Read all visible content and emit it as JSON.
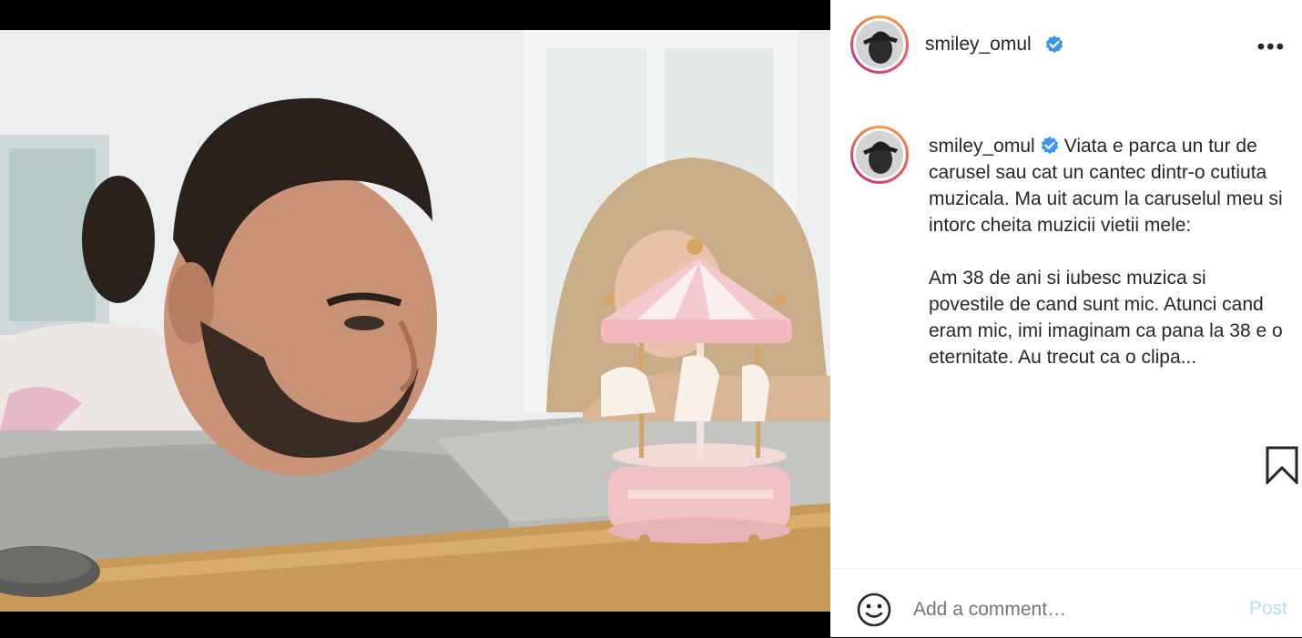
{
  "post": {
    "username": "smiley_omul",
    "more_icon": "more-horizontal-icon",
    "caption": "Viata e parca un tur de carusel sau cat un cantec dintr-o cutiuta muzicala. Ma uit acum la caruselul meu si intorc cheita muzicii vietii mele:\n\nAm 38 de ani si iubesc muzica si povestile de cand sunt mic. Atunci cand eram mic, imi imaginam ca pana la 38 e o eternitate. Au trecut ca o clipa...",
    "image_alt": "Man with a man bun looking at a pink toy carousel music box on a table, a blonde woman watching behind"
  },
  "comment": {
    "placeholder": "Add a comment…",
    "post_label": "Post"
  },
  "colors": {
    "verified": "#3897f0",
    "post_button": "#b2dffc",
    "text": "#262626"
  }
}
